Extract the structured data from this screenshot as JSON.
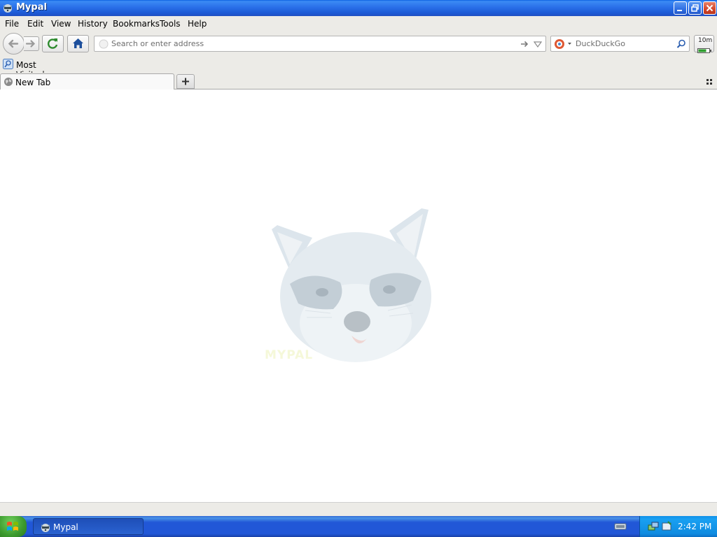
{
  "window": {
    "title": "Mypal"
  },
  "menu": [
    "File",
    "Edit",
    "View",
    "History",
    "Bookmarks",
    "Tools",
    "Help"
  ],
  "navbar": {
    "address_placeholder": "Search or enter address",
    "search_engine": "DuckDuckGo",
    "timer_label": "10m"
  },
  "bookmarks": {
    "most_visited": "Most Visited"
  },
  "tabs": [
    {
      "label": "New Tab"
    }
  ],
  "content": {
    "logo_text": "MYPAL"
  },
  "taskbar": {
    "task_label": "Mypal",
    "clock": "2:42 PM"
  }
}
